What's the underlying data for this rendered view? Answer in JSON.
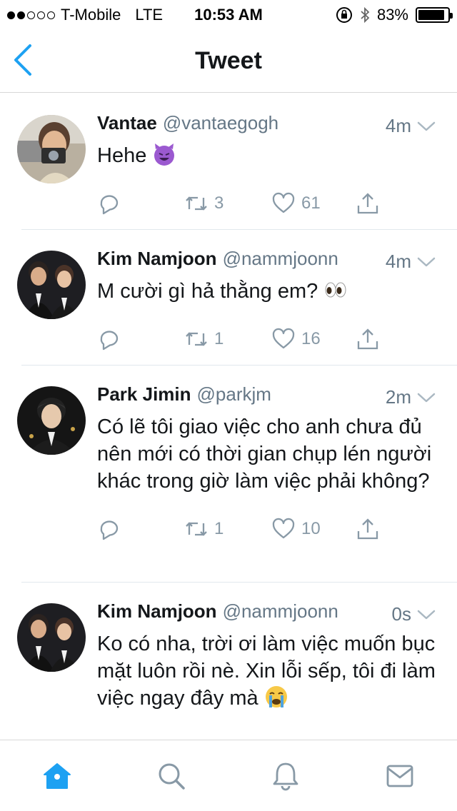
{
  "status_bar": {
    "carrier": "T-Mobile",
    "network": "LTE",
    "time": "10:53 AM",
    "battery": "83%",
    "battery_level": 0.83
  },
  "nav": {
    "title": "Tweet",
    "back_icon": "chevron-left-icon"
  },
  "tweets": [
    {
      "name": "Vantae",
      "handle": "@vantaegogh",
      "time": "4m",
      "text": "Hehe",
      "emoji": "😈",
      "retweets": "3",
      "likes": "61"
    },
    {
      "name": "Kim Namjoon",
      "handle": "@nammjoonn",
      "time": "4m",
      "text": "M cười gì hả thằng em?",
      "emoji": "👀",
      "retweets": "1",
      "likes": "16"
    },
    {
      "name": "Park Jimin",
      "handle": "@parkjm",
      "time": "2m",
      "text": "Có lẽ tôi giao việc cho anh chưa đủ nên mới có thời gian chụp lén người khác trong giờ làm việc phải không?",
      "retweets": "1",
      "likes": "10"
    },
    {
      "name": "Kim Namjoon",
      "handle": "@nammjoonn",
      "time": "0s",
      "text": "Ko có nha, trời ơi làm việc muốn bục mặt luôn rồi nè. Xin lỗi sếp, tôi đi làm việc ngay đây mà",
      "emoji": "😭"
    }
  ],
  "colors": {
    "accent": "#1da1f2",
    "muted": "#8899a6",
    "text": "#14171a"
  },
  "tab_bar": [
    "home-icon",
    "search-icon",
    "notifications-icon",
    "messages-icon"
  ]
}
